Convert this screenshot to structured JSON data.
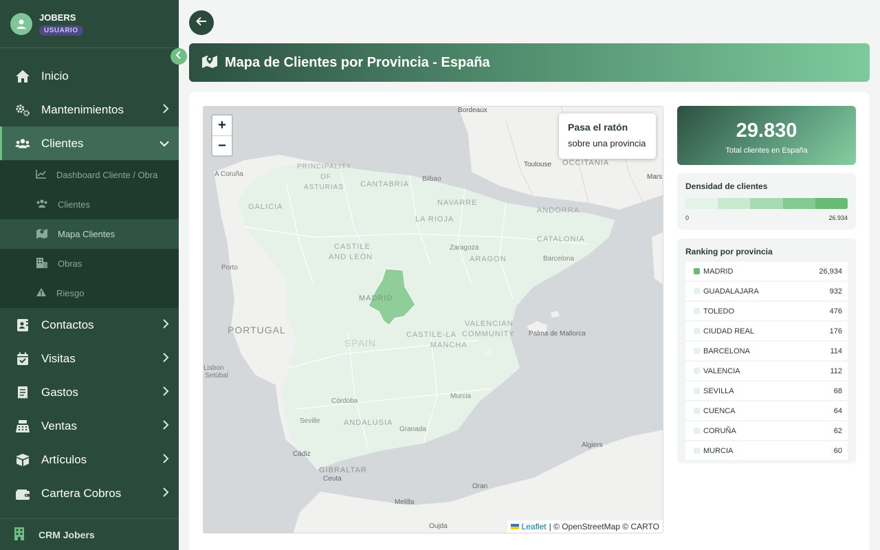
{
  "user": {
    "name": "JOBERS",
    "role": "USUARIO"
  },
  "sidebar": {
    "items": [
      {
        "label": "Inicio",
        "icon": "home-icon"
      },
      {
        "label": "Mantenimientos",
        "icon": "gears-icon"
      },
      {
        "label": "Clientes",
        "icon": "users-icon"
      },
      {
        "label": "Contactos",
        "icon": "contact-card-icon"
      },
      {
        "label": "Visitas",
        "icon": "calendar-check-icon"
      },
      {
        "label": "Gastos",
        "icon": "receipt-icon"
      },
      {
        "label": "Ventas",
        "icon": "cash-register-icon"
      },
      {
        "label": "Artículos",
        "icon": "box-icon"
      },
      {
        "label": "Cartera Cobros",
        "icon": "wallet-icon"
      }
    ],
    "clientes_sub": [
      {
        "label": "Dashboard Cliente / Obra",
        "icon": "chart-line-icon"
      },
      {
        "label": "Clientes",
        "icon": "users-icon"
      },
      {
        "label": "Mapa Clientes",
        "icon": "map-marker-icon"
      },
      {
        "label": "Obras",
        "icon": "building-icon"
      },
      {
        "label": "Riesgo",
        "icon": "warning-icon"
      }
    ],
    "footer": "CRM Jobers"
  },
  "header": {
    "title": "Mapa de Clientes por Provincia - España"
  },
  "map": {
    "zoom_in": "+",
    "zoom_out": "−",
    "info_title": "Pasa el ratón",
    "info_sub": "sobre una provincia",
    "attribution_link": "Leaflet",
    "attribution_text": "| © OpenStreetMap © CARTO",
    "labels": {
      "bordeaux": "Bordeaux",
      "toulouse": "Toulouse",
      "occitania": "OCCITANIA",
      "marseille": "Mars",
      "principality": "PRINCIPALITY",
      "of": "OF",
      "asturias": "ASTURIAS",
      "cantabria": "CANTABRIA",
      "bilbao": "Bilbao",
      "acoruna": "A Coruña",
      "galicia": "GALICIA",
      "navarre": "NAVARRE",
      "andorra": "ANDORRA",
      "larioja": "LA RIOJA",
      "castile_leon_1": "CASTILE",
      "castile_leon_2": "AND LEÓN",
      "zaragoza": "Zaragoza",
      "aragon": "ARAGON",
      "catalonia": "CATALONIA",
      "barcelona": "Barcelona",
      "porto": "Porto",
      "madrid": "MADRID",
      "portugal": "PORTUGAL",
      "spain": "SPAIN",
      "castilla_lm_1": "CASTILE-LA",
      "castilla_lm_2": "MANCHA",
      "valencian_1": "VALENCIAN",
      "valencian_2": "COMMUNITY",
      "palma": "Palma de Mallorca",
      "lisbon": "Lisbon",
      "setubal": "Setúbal",
      "cordoba": "Córdoba",
      "murcia": "Murcia",
      "sevilla": "Seville",
      "andalusia": "ANDALUSIA",
      "granada": "Granada",
      "cadiz": "Cádiz",
      "gibraltar": "GIBRALTAR",
      "ceuta": "Ceuta",
      "algiers": "Algiers",
      "oran": "Oran",
      "melilla": "Melilla",
      "oujda": "Oujda"
    }
  },
  "total": {
    "value": "29.830",
    "label": "Total clientes en España"
  },
  "density": {
    "title": "Densidad de clientes",
    "min": "0",
    "max": "26.934",
    "colors": [
      "#e3f3e7",
      "#c9e9d1",
      "#a7dab3",
      "#83ca92",
      "#67bb74"
    ]
  },
  "ranking": {
    "title": "Ranking por provincia",
    "rows": [
      {
        "name": "MADRID",
        "value": "26,934",
        "color": "#67bb74"
      },
      {
        "name": "GUADALAJARA",
        "value": "932",
        "color": "#e3f3e7"
      },
      {
        "name": "TOLEDO",
        "value": "476",
        "color": "#e3f3e7"
      },
      {
        "name": "CIUDAD REAL",
        "value": "176",
        "color": "#e3f3e7"
      },
      {
        "name": "BARCELONA",
        "value": "114",
        "color": "#e3f3e7"
      },
      {
        "name": "VALENCIA",
        "value": "112",
        "color": "#e3f3e7"
      },
      {
        "name": "SEVILLA",
        "value": "68",
        "color": "#e3f3e7"
      },
      {
        "name": "CUENCA",
        "value": "64",
        "color": "#e3f3e7"
      },
      {
        "name": "CORUÑA",
        "value": "62",
        "color": "#e3f3e7"
      },
      {
        "name": "MURCIA",
        "value": "60",
        "color": "#e3f3e7"
      }
    ]
  }
}
